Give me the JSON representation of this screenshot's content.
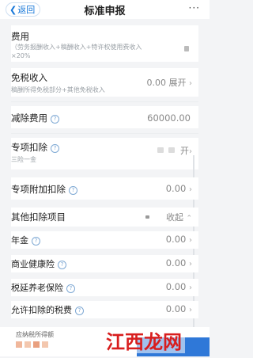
{
  "header": {
    "back_label": "返回",
    "title": "标准申报",
    "more": "···"
  },
  "fee": {
    "label": "费用",
    "note_line1": "（劳务报酬收入+稿酬收入+特许权使用费收入",
    "note_line2": "×20%"
  },
  "exempt": {
    "label": "免税收入",
    "note": "稿酬所得免税部分+其他免税收入",
    "value": "0.00",
    "action": "展开"
  },
  "deduct_fee": {
    "label": "减除费用",
    "value": "60000.00"
  },
  "special": {
    "label": "专项扣除",
    "note": "三险一金",
    "action": "开"
  },
  "special_additional": {
    "label": "专项附加扣除",
    "value": "0.00"
  },
  "other": {
    "label": "其他扣除项目",
    "action": "收起"
  },
  "other_items": [
    {
      "label": "年金",
      "has_help": true,
      "value": "0.00"
    },
    {
      "label": "商业健康险",
      "has_help": true,
      "value": "0.00"
    },
    {
      "label": "税延养老保险",
      "has_help": true,
      "value": "0.00"
    },
    {
      "label": "允许扣除的税费",
      "has_help": true,
      "value": "0.00"
    }
  ],
  "bottom": {
    "label": "应纳税所得额"
  },
  "watermark": "江西龙网",
  "colors": {
    "accent": "#1677d9",
    "watermark": "#d81e1e"
  }
}
